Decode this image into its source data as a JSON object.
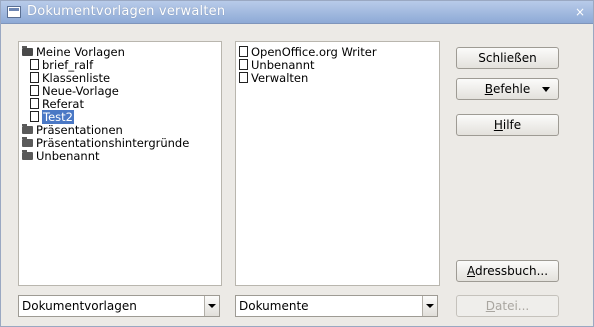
{
  "window": {
    "title": "Dokumentvorlagen verwalten",
    "close_glyph": "×"
  },
  "left_tree": [
    {
      "label": "Meine Vorlagen",
      "icon": "folder-open-icon",
      "level": 0
    },
    {
      "label": "brief_ralf",
      "icon": "document-icon",
      "level": 1
    },
    {
      "label": "Klassenliste",
      "icon": "document-icon",
      "level": 1
    },
    {
      "label": "Neue-Vorlage",
      "icon": "document-icon",
      "level": 1
    },
    {
      "label": "Referat",
      "icon": "document-icon",
      "level": 1
    },
    {
      "label": "Test2",
      "icon": "document-icon",
      "level": 1,
      "selected": true
    },
    {
      "label": "Präsentationen",
      "icon": "folder-icon",
      "level": 0
    },
    {
      "label": "Präsentationshintergründe",
      "icon": "folder-icon",
      "level": 0
    },
    {
      "label": "Unbenannt",
      "icon": "folder-icon",
      "level": 0
    }
  ],
  "right_tree": [
    {
      "label": "OpenOffice.org Writer",
      "icon": "document-icon"
    },
    {
      "label": "Unbenannt",
      "icon": "document-icon"
    },
    {
      "label": "Verwalten",
      "icon": "document-icon"
    }
  ],
  "buttons": {
    "close": "Schließen",
    "commands_prefix": "B",
    "commands_rest": "efehle",
    "help_prefix": "H",
    "help_rest": "ilfe",
    "addressbook_prefix": "A",
    "addressbook_rest": "dressbuch...",
    "file_prefix": "D",
    "file_rest": "atei..."
  },
  "selects": {
    "left_value": "Dokumentvorlagen",
    "right_value": "Dokumente"
  },
  "colors": {
    "titlebar": "#8eaad6",
    "selection": "#4a78c5"
  }
}
